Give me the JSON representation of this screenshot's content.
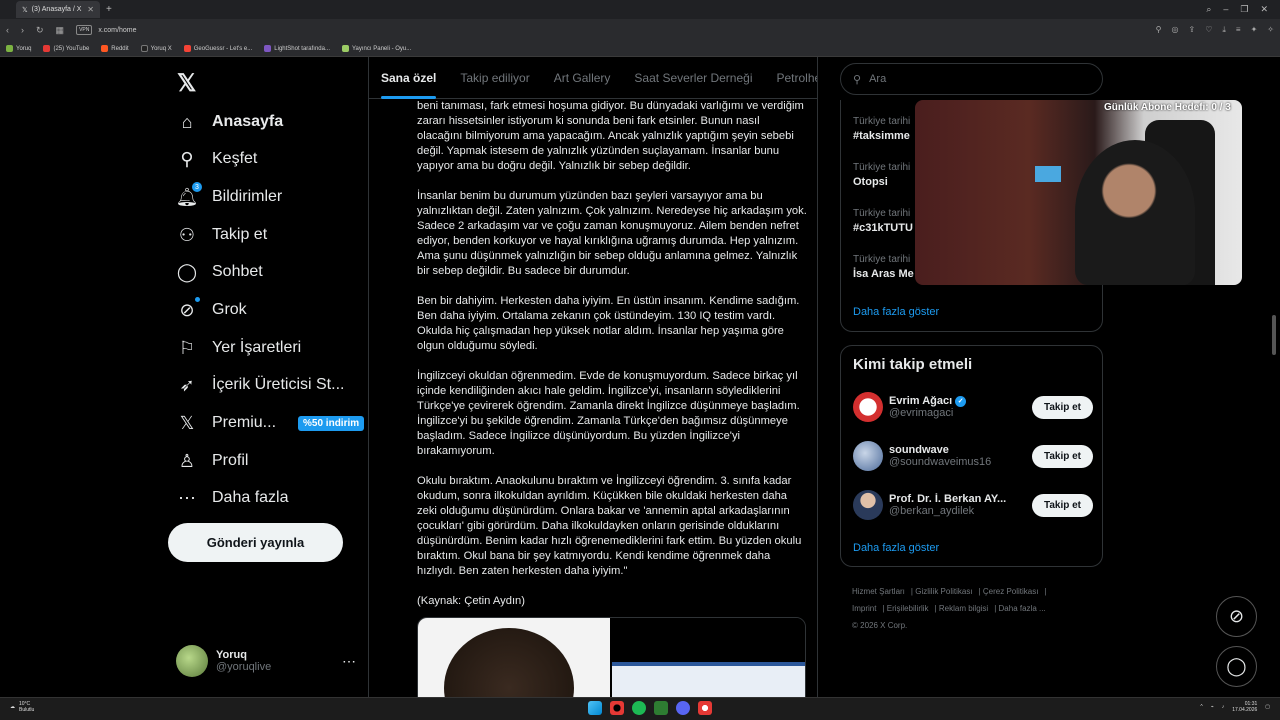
{
  "browser": {
    "tab_title": "(3) Anasayfa / X",
    "url": "x.com/home",
    "vpn": "VPN",
    "bookmarks": [
      "Yoruq",
      "(25) YouTube",
      "Reddit",
      "Yoruq X",
      "GeoGuessr - Let's e...",
      "LightShot tarafında...",
      "Yayıncı Paneli - Oyu..."
    ]
  },
  "nav": {
    "items": [
      {
        "label": "Anasayfa",
        "icon": "home-icon"
      },
      {
        "label": "Keşfet",
        "icon": "search-icon"
      },
      {
        "label": "Bildirimler",
        "icon": "bell-icon",
        "badge": "3"
      },
      {
        "label": "Takip et",
        "icon": "add-user-icon"
      },
      {
        "label": "Sohbet",
        "icon": "chat-icon"
      },
      {
        "label": "Grok",
        "icon": "grok-icon"
      },
      {
        "label": "Yer İşaretleri",
        "icon": "bookmark-icon"
      },
      {
        "label": "İçerik Üreticisi St...",
        "icon": "rocket-icon"
      },
      {
        "label": "Premiu...",
        "icon": "x-icon",
        "promo": "%50 indirim"
      },
      {
        "label": "Profil",
        "icon": "person-icon"
      },
      {
        "label": "Daha fazla",
        "icon": "more-icon"
      }
    ],
    "post_button": "Gönderi yayınla",
    "profile": {
      "name": "Yoruq",
      "handle": "@yoruqlive"
    }
  },
  "tabs": [
    "Sana özel",
    "Takip ediliyor",
    "Art Gallery",
    "Saat Severler Derneği",
    "Petrolhea"
  ],
  "post": {
    "paragraphs": [
      "beni tanıması, fark etmesi hoşuma gidiyor. Bu dünyadaki varlığımı ve verdiğim zararı hissetsinler istiyorum ki sonunda beni fark etsinler. Bunun nasıl olacağını bilmiyorum ama yapacağım. Ancak yalnızlık yaptığım şeyin sebebi değil. Yapmak istesem de yalnızlık yüzünden suçlayamam. İnsanlar bunu yapıyor ama bu doğru değil. Yalnızlık bir sebep değildir.",
      "İnsanlar benim bu durumum yüzünden bazı şeyleri varsayıyor ama bu yalnızlıktan değil. Zaten yalnızım. Çok yalnızım. Neredeyse hiç arkadaşım yok. Sadece 2 arkadaşım var ve çoğu zaman konuşmuyoruz. Ailem benden nefret ediyor, benden korkuyor ve hayal kırıklığına uğramış durumda. Hep yalnızım. Ama şunu düşünmek yalnızlığın bir sebep olduğu anlamına gelmez. Yalnızlık bir sebep değildir. Bu sadece bir durumdur.",
      "Ben bir dahiyim. Herkesten daha iyiyim. En üstün insanım. Kendime sadığım. Ben daha iyiyim. Ortalama zekanın çok üstündeyim. 130 IQ testim vardı. Okulda hiç çalışmadan hep yüksek notlar aldım. İnsanlar hep yaşıma göre olgun olduğumu söyledi.",
      "İngilizceyi okuldan öğrenmedim. Evde de konuşmuyordum. Sadece birkaç yıl içinde kendiliğinden akıcı hale geldim. İngilizce'yi, insanların söylediklerini Türkçe'ye çevirerek öğrendim. Zamanla direkt İngilizce düşünmeye başladım. İngilizce'yi bu şekilde öğrendim. Zamanla Türkçe'den bağımsız düşünmeye başladım. Sadece İngilizce düşünüyordum. Bu yüzden İngilizce'yi bırakamıyorum.",
      "Okulu bıraktım. Anaokulunu bıraktım ve İngilizceyi öğrendim. 3. sınıfa kadar okudum, sonra ilkokuldan ayrıldım. Küçükken bile okuldaki herkesten daha zeki olduğumu düşünürdüm. Onlara bakar ve 'annemin aptal arkadaşlarının çocukları' gibi görürdüm. Daha ilkokuldayken onların gerisinde olduklarını düşünürdüm. Benim kadar hızlı öğrenemediklerini fark ettim. Bu yüzden okulu bıraktım. Okul bana bir şey katmıyordu. Kendi kendime öğrenmek daha hızlıydı. Ben zaten herkesten daha iyiyim.\"",
      "(Kaynak: Çetin Aydın)"
    ]
  },
  "right": {
    "search_placeholder": "Ara",
    "trends": [
      {
        "meta": "Türkiye tarihi",
        "name": "#taksimme"
      },
      {
        "meta": "Türkiye tarihi",
        "name": "Otopsi"
      },
      {
        "meta": "Türkiye tarihi",
        "name": "#c31kTUTU"
      },
      {
        "meta": "Türkiye tarihi",
        "name": "İsa Aras Me"
      }
    ],
    "show_more": "Daha fazla göster",
    "who_to_follow": {
      "title": "Kimi takip etmeli",
      "accounts": [
        {
          "name": "Evrim Ağacı",
          "handle": "@evrimagaci",
          "verified": true,
          "button": "Takip et"
        },
        {
          "name": "soundwave",
          "handle": "@soundwaveimus16",
          "verified": false,
          "button": "Takip et"
        },
        {
          "name": "Prof. Dr. İ. Berkan AY...",
          "handle": "@berkan_aydilek",
          "verified": false,
          "button": "Takip et"
        }
      ],
      "show_more": "Daha fazla göster"
    },
    "footer": [
      "Hizmet Şartları",
      "Gizlilik Politikası",
      "Çerez Politikası",
      "Imprint",
      "Erişilebilirlik",
      "Reklam bilgisi",
      "Daha fazla ...",
      "© 2026 X Corp."
    ]
  },
  "overlay": {
    "label": "Günlük Abone Hedefi: 0 / 3"
  },
  "taskbar": {
    "temp": "10°C",
    "weather": "Bulutlu",
    "time": "01:31",
    "date": "17.04.2026"
  }
}
